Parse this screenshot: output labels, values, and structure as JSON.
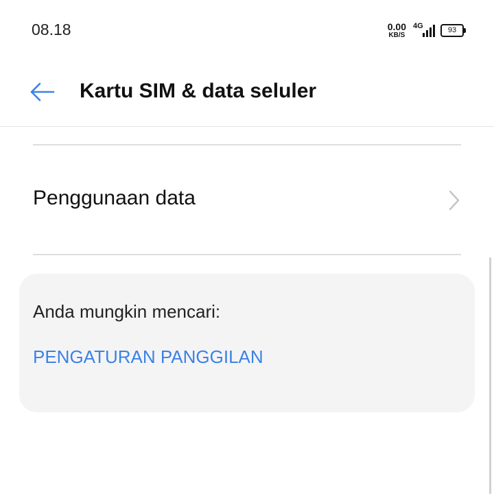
{
  "status_bar": {
    "time": "08.18",
    "net_speed_value": "0.00",
    "net_speed_unit": "KB/S",
    "network_type": "4G",
    "battery_level": "93",
    "icons": [
      "network-speed-icon",
      "signal-icon",
      "battery-icon"
    ]
  },
  "header": {
    "title": "Kartu SIM & data seluler",
    "back_icon": "arrow-left-icon",
    "accent_color": "#3b82e6"
  },
  "settings": {
    "items": [
      {
        "label": "Penggunaan data",
        "icon": "chevron-right-icon"
      }
    ]
  },
  "suggestions": {
    "heading": "Anda mungkin mencari:",
    "links": [
      {
        "label": "PENGATURAN PANGGILAN"
      }
    ],
    "link_color": "#3b82e6"
  }
}
